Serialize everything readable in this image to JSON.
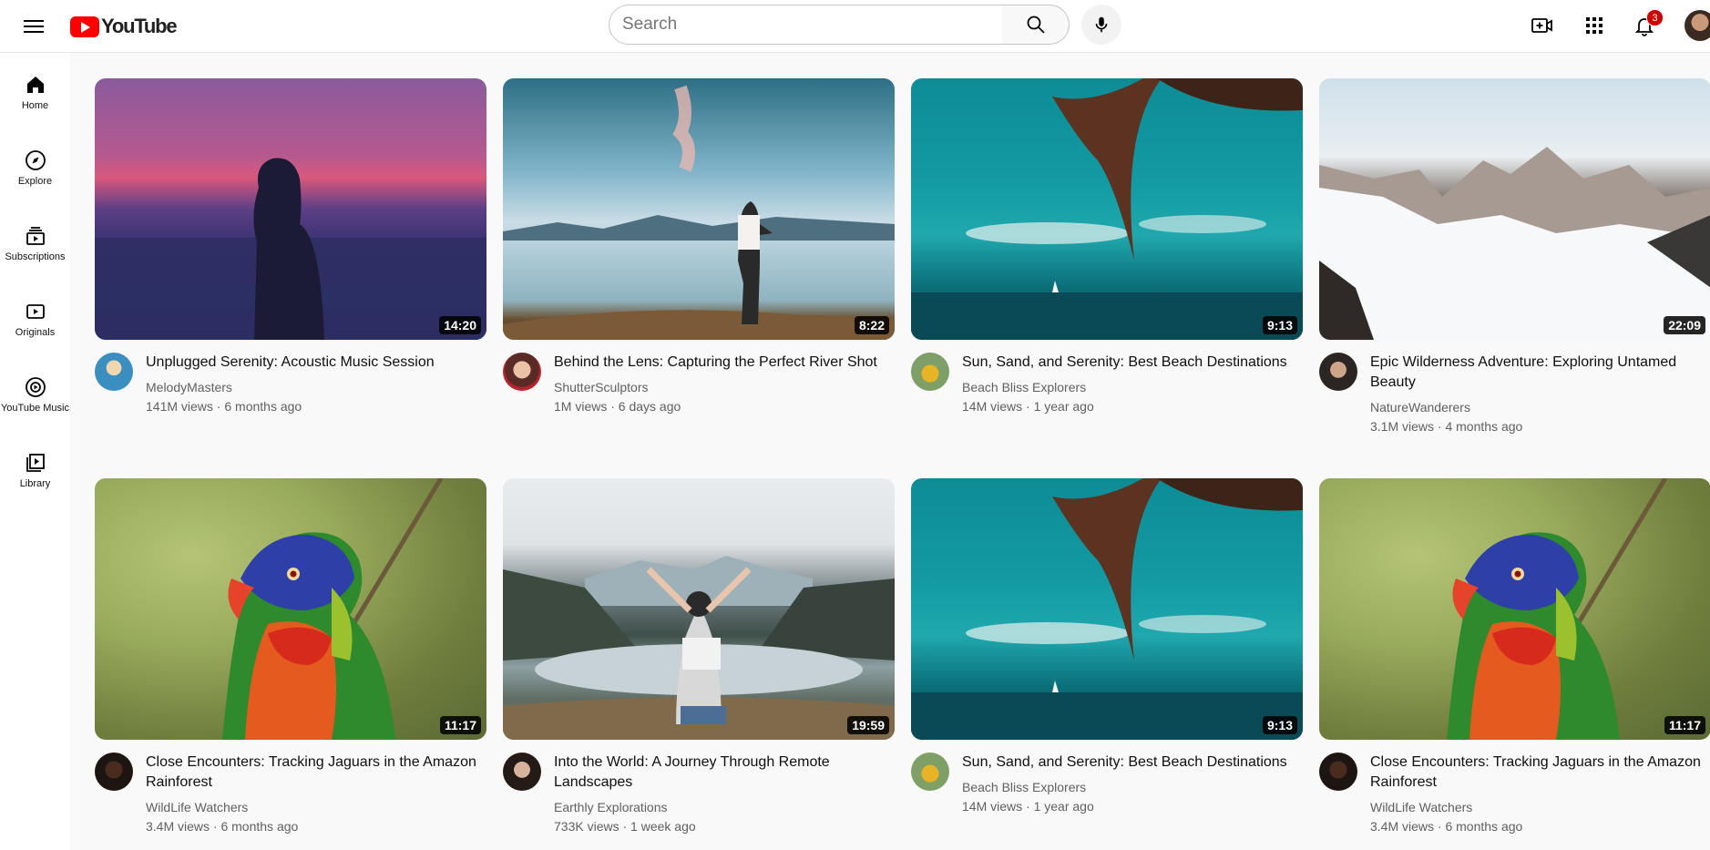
{
  "header": {
    "logo_text": "YouTube",
    "search_placeholder": "Search",
    "notification_count": "3"
  },
  "sidebar": {
    "items": [
      {
        "label": "Home",
        "icon": "home-icon"
      },
      {
        "label": "Explore",
        "icon": "compass-icon"
      },
      {
        "label": "Subscriptions",
        "icon": "subscriptions-icon"
      },
      {
        "label": "Originals",
        "icon": "originals-icon"
      },
      {
        "label": "YouTube Music",
        "icon": "music-icon"
      },
      {
        "label": "Library",
        "icon": "library-icon"
      }
    ]
  },
  "videos": [
    {
      "title": "Unplugged Serenity: Acoustic Music Session",
      "channel": "MelodyMasters",
      "stats": "141M views · 6 months ago",
      "duration": "14:20",
      "thumbnail": "sunset-silhouette"
    },
    {
      "title": "Behind the Lens: Capturing the Perfect River Shot",
      "channel": "ShutterSculptors",
      "stats": "1M views · 6 days ago",
      "duration": "8:22",
      "thumbnail": "lake-man"
    },
    {
      "title": "Sun, Sand, and Serenity: Best Beach Destinations",
      "channel": "Beach Bliss Explorers",
      "stats": "14M views · 1 year ago",
      "duration": "9:13",
      "thumbnail": "beach-palm"
    },
    {
      "title": "Epic Wilderness Adventure: Exploring Untamed Beauty",
      "channel": "NatureWanderers",
      "stats": "3.1M views · 4 months ago",
      "duration": "22:09",
      "thumbnail": "snow-mountains"
    },
    {
      "title": "Close Encounters: Tracking Jaguars in the Amazon Rainforest",
      "channel": "WildLife Watchers",
      "stats": "3.4M views · 6 months ago",
      "duration": "11:17",
      "thumbnail": "parrot"
    },
    {
      "title": "Into the World: A Journey Through Remote Landscapes",
      "channel": "Earthly Explorations",
      "stats": "733K views · 1 week ago",
      "duration": "19:59",
      "thumbnail": "mountain-lake-woman"
    },
    {
      "title": "Sun, Sand, and Serenity: Best Beach Destinations",
      "channel": "Beach Bliss Explorers",
      "stats": "14M views · 1 year ago",
      "duration": "9:13",
      "thumbnail": "beach-palm"
    },
    {
      "title": "Close Encounters: Tracking Jaguars in the Amazon Rainforest",
      "channel": "WildLife Watchers",
      "stats": "3.4M views · 6 months ago",
      "duration": "11:17",
      "thumbnail": "parrot"
    }
  ]
}
